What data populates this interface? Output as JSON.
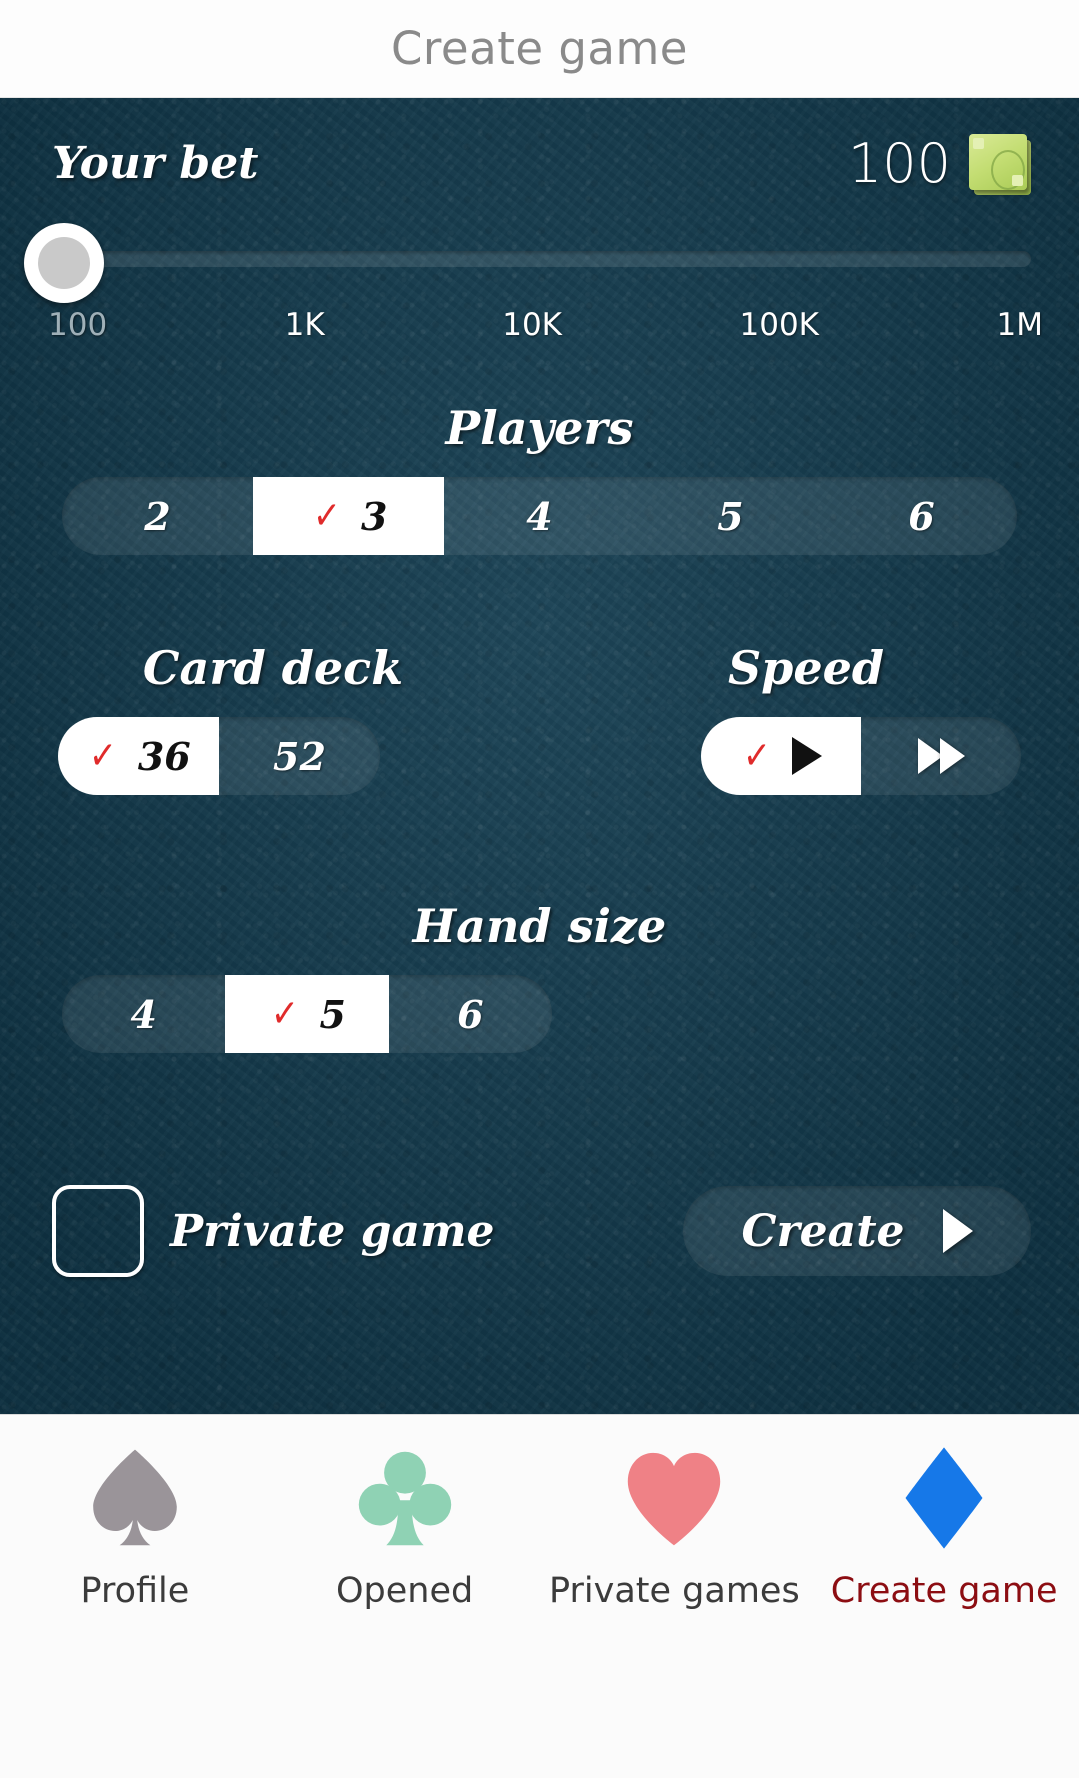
{
  "header": {
    "title": "Create game"
  },
  "bet": {
    "label": "Your bet",
    "amount": "100",
    "money_icon": "money-bill-icon",
    "slider": {
      "value": "100",
      "position_percent": 0,
      "ticks": [
        "100",
        "1K",
        "10K",
        "100K",
        "1M"
      ]
    }
  },
  "players": {
    "title": "Players",
    "options": [
      "2",
      "3",
      "4",
      "5",
      "6"
    ],
    "selected": "3",
    "check_icon": "red-checkmark-icon"
  },
  "card_deck": {
    "title": "Card deck",
    "options": [
      "36",
      "52"
    ],
    "selected": "36"
  },
  "speed": {
    "title": "Speed",
    "options": [
      {
        "icon": "play-triangle-icon",
        "label": ""
      },
      {
        "icon": "fast-forward-icon",
        "label": ""
      }
    ],
    "selected_index": 0
  },
  "hand_size": {
    "title": "Hand size",
    "options": [
      "4",
      "5",
      "6"
    ],
    "selected": "5"
  },
  "private_game": {
    "label": "Private game",
    "checked": false,
    "checkbox_icon": "empty-checkbox-icon"
  },
  "create_button": {
    "label": "Create",
    "arrow_icon": "play-arrow-icon"
  },
  "navbar": {
    "items": [
      {
        "label": "Profile",
        "icon": "spade-icon",
        "color": "#9a9499",
        "active": false
      },
      {
        "label": "Opened",
        "icon": "club-icon",
        "color": "#8fd2b4",
        "active": false
      },
      {
        "label": "Private games",
        "icon": "heart-icon",
        "color": "#ef8186",
        "active": false
      },
      {
        "label": "Create game",
        "icon": "diamond-icon",
        "color": "#1678e8",
        "active": true
      }
    ]
  },
  "colors": {
    "board_bg": "#113b4f",
    "header_text": "#8a8a8a",
    "check_red": "#e02b2b",
    "active_nav": "#8c0d12"
  }
}
